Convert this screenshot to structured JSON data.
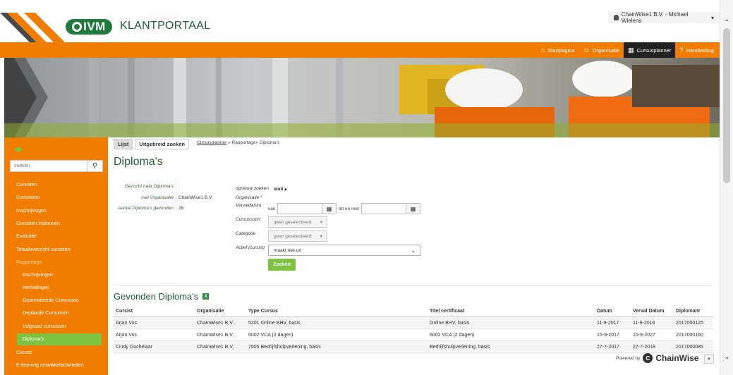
{
  "header": {
    "logo_text": "IVM",
    "title": "KLANTPORTAAL",
    "user": "ChainWise1 B.V. - Michael Wielens"
  },
  "nav": {
    "items": [
      {
        "label": "Startpagina",
        "icon": "home-icon"
      },
      {
        "label": "Organisatie",
        "icon": "users-icon"
      },
      {
        "label": "Cursusplanner",
        "icon": "calendar-icon",
        "active": true
      },
      {
        "label": "Handleiding",
        "icon": "help-icon"
      }
    ]
  },
  "sidebar": {
    "search_placeholder": "zoeken",
    "items": [
      {
        "label": "Cursisten"
      },
      {
        "label": "Cursussen"
      },
      {
        "label": "Inschrijvingen"
      },
      {
        "label": "Cursisten inplannen"
      },
      {
        "label": "Evaluatie"
      },
      {
        "label": "Totaaloverzicht cursisten"
      },
      {
        "label": "Rapportage"
      },
      {
        "label": "Inschrijvingen"
      },
      {
        "label": "Herhalingen"
      },
      {
        "label": "Geannuleerde Cursussen"
      },
      {
        "label": "Geplande Cursussen"
      },
      {
        "label": "Vulgraad cursussen"
      },
      {
        "label": "Diploma's"
      },
      {
        "label": "Cursist"
      },
      {
        "label": "E-learning ontwikkelactiviteiten"
      }
    ]
  },
  "tabs": {
    "list": "Lijst",
    "advanced": "Uitgebreid zoeken"
  },
  "breadcrumb": {
    "link": "Cursusplanner",
    "rest": " » Rapportage» Diploma's"
  },
  "page_title": "Diploma's",
  "summary": {
    "searched_label": "Gezocht naar Diploma's",
    "org_label": "met Organisatie",
    "org_value": "ChainWise1 B.V.",
    "count_label": "Aantal Diploma's gevonden",
    "count_value": "26"
  },
  "form": {
    "research_label": "opnieuw zoeken",
    "close_label": "sluit",
    "org_label": "Organisatie *",
    "expiry_label": "Vervaldatum",
    "from_label": "van",
    "to_label": "tot en met",
    "course_type_label": "Cursussoort",
    "course_type_value": "geen geselecteerd",
    "category_label": "Categorie",
    "category_value": "geen geselecteerd",
    "active_label": "Actief (cursist)",
    "active_value": "maakt niet uit",
    "submit": "Zoeken"
  },
  "results": {
    "title": "Gevonden Diploma's",
    "columns": [
      "Cursist",
      "Organisatie",
      "Type Cursus",
      "Titel certificaat",
      "Datum",
      "Verval Datum",
      "Diplomanr"
    ],
    "rows": [
      [
        "Arjan Vos",
        "ChainWise1 B.V.",
        "5201 Online BHV, basis",
        "Online BHV, basis",
        "11-9-2017",
        "11-9-2018",
        "2017000125"
      ],
      [
        "Arjan Vos",
        "ChainWise1 B.V.",
        "6002 VCA (2 dagen)",
        "6002 VCA (2 dagen)",
        "15-9-2017",
        "15-9-2027",
        "2017000160"
      ],
      [
        "Cindy Guchelaar",
        "ChainWise1 B.V.",
        "7005 Bedrijfshulpverlening, basis",
        "Bedrijfshulpverlening, basis",
        "27-7-2017",
        "27-7-2018",
        "2017000085"
      ]
    ]
  },
  "footer": {
    "powered_by": "Powered by",
    "brand": "ChainWise"
  },
  "colors": {
    "accent": "#f07d00",
    "green": "#7dc241",
    "title_green": "#1f5f33"
  }
}
